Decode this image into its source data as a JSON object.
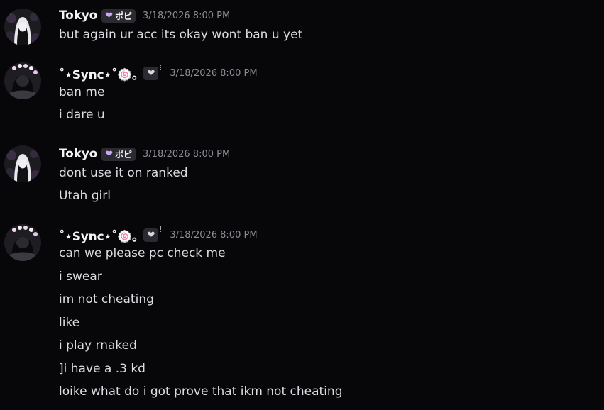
{
  "messages": [
    {
      "username": "Tokyo",
      "tag": "ポピ",
      "timestamp": "3/18/2026 8:00 PM",
      "lines": [
        "but again ur acc its okay wont ban u yet"
      ]
    },
    {
      "username": "˚⋆Sync⋆˚🍥｡",
      "tag": "",
      "timestamp": "3/18/2026 8:00 PM",
      "lines": [
        "ban me",
        "i dare u"
      ]
    },
    {
      "username": "Tokyo",
      "tag": "ポピ",
      "timestamp": "3/18/2026 8:00 PM",
      "lines": [
        "dont use it on ranked",
        "Utah girl"
      ]
    },
    {
      "username": "˚⋆Sync⋆˚🍥｡",
      "tag": "",
      "timestamp": "3/18/2026 8:00 PM",
      "lines": [
        "can we please pc check me",
        "i swear",
        "im not cheating",
        "like",
        "i play rnaked",
        "]i have a .3 kd",
        "loike what do i got prove that ikm not cheating"
      ]
    }
  ],
  "icons": {
    "tag_heart": "heart-icon",
    "avatar_tokyo": "avatar",
    "avatar_sync": "avatar"
  },
  "colors": {
    "background": "#070709",
    "username": "#f2f3f5",
    "text": "#dcdde2",
    "timestamp": "#8a8d94",
    "tag_bg": "#2a2a30",
    "tag_heart_tokyo": "#c9a7f5"
  }
}
